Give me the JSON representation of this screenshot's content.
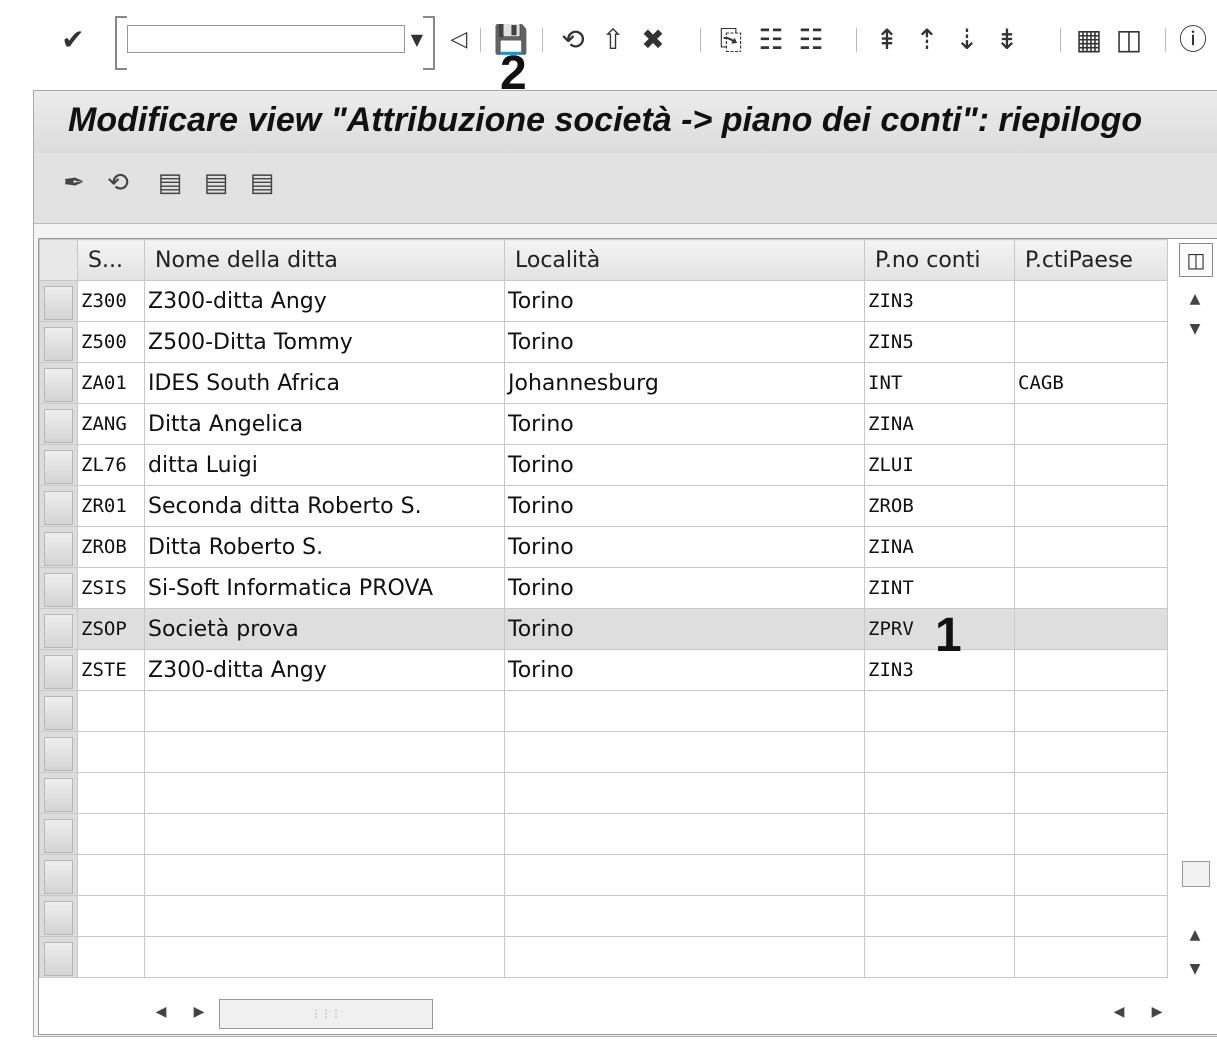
{
  "toolbar": {
    "command_value": "",
    "icons": [
      "enter-icon",
      "back-icon",
      "save-icon",
      "back-nav-icon",
      "exit-icon",
      "cancel-icon",
      "print-icon",
      "find-icon",
      "find-next-icon",
      "first-page-icon",
      "previous-page-icon",
      "next-page-icon",
      "last-page-icon",
      "create-session-icon",
      "shortcut-icon",
      "help-icon"
    ]
  },
  "annotations": {
    "a1": "1",
    "a2": "2"
  },
  "screen": {
    "title": "Modificare view \"Attribuzione società -> piano dei conti\": riepilogo"
  },
  "app_toolbar": {
    "icons": [
      "display-change-icon",
      "undo-icon",
      "select-all-icon",
      "select-block-icon",
      "deselect-all-icon"
    ]
  },
  "table": {
    "headers": {
      "company_code": "S...",
      "company_name": "Nome della ditta",
      "city": "Località",
      "chart_of_accounts": "P.no conti",
      "country_chart": "P.ctiPaese"
    },
    "rows": [
      {
        "code": "Z300",
        "name": "Z300-ditta Angy",
        "city": "Torino",
        "coa": "ZIN3",
        "country_coa": ""
      },
      {
        "code": "Z500",
        "name": "Z500-Ditta Tommy",
        "city": "Torino",
        "coa": "ZIN5",
        "country_coa": ""
      },
      {
        "code": "ZA01",
        "name": "IDES South Africa",
        "city": "Johannesburg",
        "coa": "INT",
        "country_coa": "CAGB"
      },
      {
        "code": "ZANG",
        "name": "Ditta Angelica",
        "city": "Torino",
        "coa": "ZINA",
        "country_coa": ""
      },
      {
        "code": "ZL76",
        "name": "ditta Luigi",
        "city": "Torino",
        "coa": "ZLUI",
        "country_coa": ""
      },
      {
        "code": "ZR01",
        "name": "Seconda ditta Roberto S.",
        "city": "Torino",
        "coa": "ZROB",
        "country_coa": ""
      },
      {
        "code": "ZROB",
        "name": "Ditta Roberto S.",
        "city": "Torino",
        "coa": "ZINA",
        "country_coa": ""
      },
      {
        "code": "ZSIS",
        "name": "Si-Soft Informatica PROVA",
        "city": "Torino",
        "coa": "ZINT",
        "country_coa": ""
      },
      {
        "code": "ZSOP",
        "name": "Società prova",
        "city": "Torino",
        "coa": "ZPRV",
        "country_coa": ""
      },
      {
        "code": "ZSTE",
        "name": "Z300-ditta Angy",
        "city": "Torino",
        "coa": "ZIN3",
        "country_coa": ""
      },
      {
        "code": "",
        "name": "",
        "city": "",
        "coa": "",
        "country_coa": ""
      },
      {
        "code": "",
        "name": "",
        "city": "",
        "coa": "",
        "country_coa": ""
      },
      {
        "code": "",
        "name": "",
        "city": "",
        "coa": "",
        "country_coa": ""
      },
      {
        "code": "",
        "name": "",
        "city": "",
        "coa": "",
        "country_coa": ""
      },
      {
        "code": "",
        "name": "",
        "city": "",
        "coa": "",
        "country_coa": ""
      },
      {
        "code": "",
        "name": "",
        "city": "",
        "coa": "",
        "country_coa": ""
      },
      {
        "code": "",
        "name": "",
        "city": "",
        "coa": "",
        "country_coa": ""
      }
    ],
    "selected_row": 8
  }
}
